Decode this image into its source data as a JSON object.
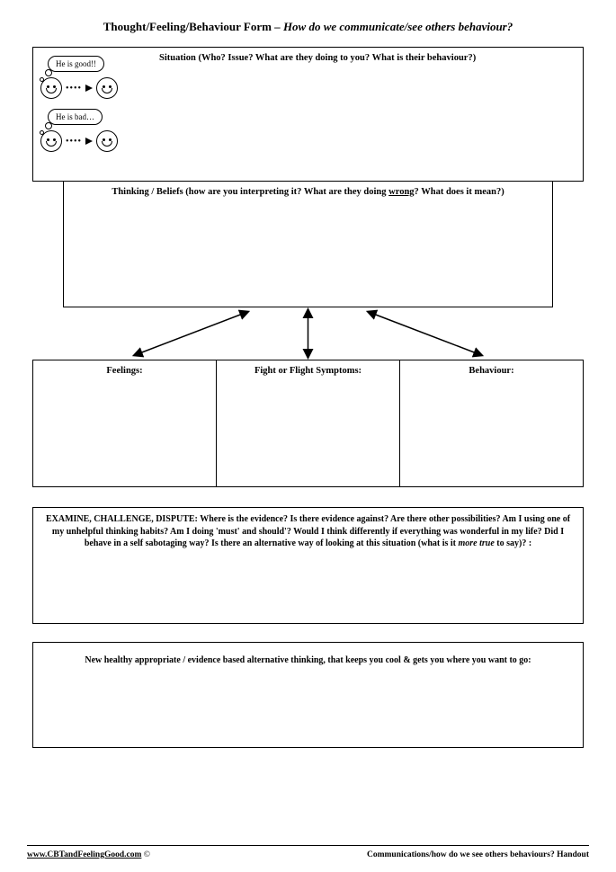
{
  "title": {
    "main": "Thought/Feeling/Behaviour Form – ",
    "sub": "How do we communicate/see others behaviour?"
  },
  "situation": {
    "heading": "Situation (Who? Issue? What are they doing to you? What is their behaviour?)",
    "bubble_good": "He is good!!",
    "bubble_bad": "He is bad…"
  },
  "thinking": {
    "heading_pre": "Thinking / Beliefs (how are you interpreting it? What are they doing ",
    "heading_underlined": "wrong",
    "heading_post": "? What does it mean?)"
  },
  "triple": {
    "col1": "Feelings:",
    "col2": "Fight or Flight Symptoms:",
    "col3": "Behaviour:"
  },
  "examine": {
    "lead": "EXAMINE, CHALLENGE, DISPUTE: ",
    "body_pre": "Where is the evidence? Is there evidence against? Are there other possibilities? Am I using one of my unhelpful thinking habits? Am I doing 'must' and should'? Would I think differently if everything was wonderful in my life? Did I behave in a self sabotaging way? Is there an alternative way of looking at this situation (what is it ",
    "body_italic": "more true",
    "body_post": " to say)? :"
  },
  "newthink": {
    "heading": "New healthy appropriate / evidence based alternative thinking, that keeps you cool & gets you where you want to go:"
  },
  "footer": {
    "site": "www.CBTandFeelingGood.com",
    "copy": " ©",
    "right": "Communications/how do we see others behaviours? Handout"
  }
}
